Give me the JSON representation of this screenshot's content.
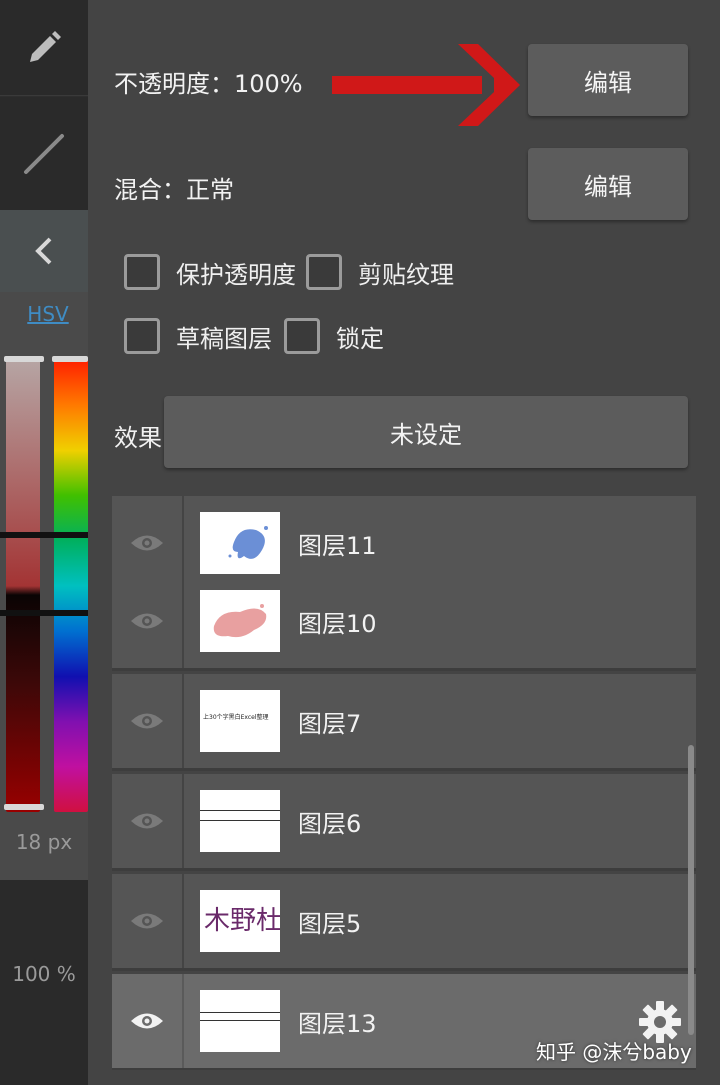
{
  "left": {
    "color_tab": "HSV",
    "brush_size": "18 px",
    "brush_opacity": "100 %"
  },
  "panel": {
    "opacity_label": "不透明度：100%",
    "blend_label": "混合：正常",
    "edit_label": "编辑",
    "checkboxes": [
      {
        "label": "保护透明度",
        "checked": false
      },
      {
        "label": "剪贴纹理",
        "checked": false
      },
      {
        "label": "草稿图层",
        "checked": false
      },
      {
        "label": "锁定",
        "checked": false
      }
    ],
    "effect_label": "效果",
    "effect_value": "未设定"
  },
  "layers": [
    {
      "name": "图层11",
      "selected": false
    },
    {
      "name": "图层10",
      "selected": false
    },
    {
      "name": "图层7",
      "selected": false
    },
    {
      "name": "图层6",
      "selected": false
    },
    {
      "name": "图层5",
      "selected": false
    },
    {
      "name": "图层13",
      "selected": true
    }
  ],
  "thumb_text": {
    "layer7": "上30个字黑白Excel整理",
    "layer5": "木野杜"
  },
  "watermark": "知乎 @沫兮baby",
  "colors": {
    "arrow": "#d01818",
    "panel_bg": "#444444",
    "button_bg": "#5c5c5c",
    "hsv_tab": "#3f8cc4"
  },
  "icons": {
    "tool_pen": "pencil-icon",
    "tool_line": "line-tool-icon",
    "collapse": "chevron-left-icon",
    "visibility": "eye-icon",
    "settings": "gear-icon"
  }
}
